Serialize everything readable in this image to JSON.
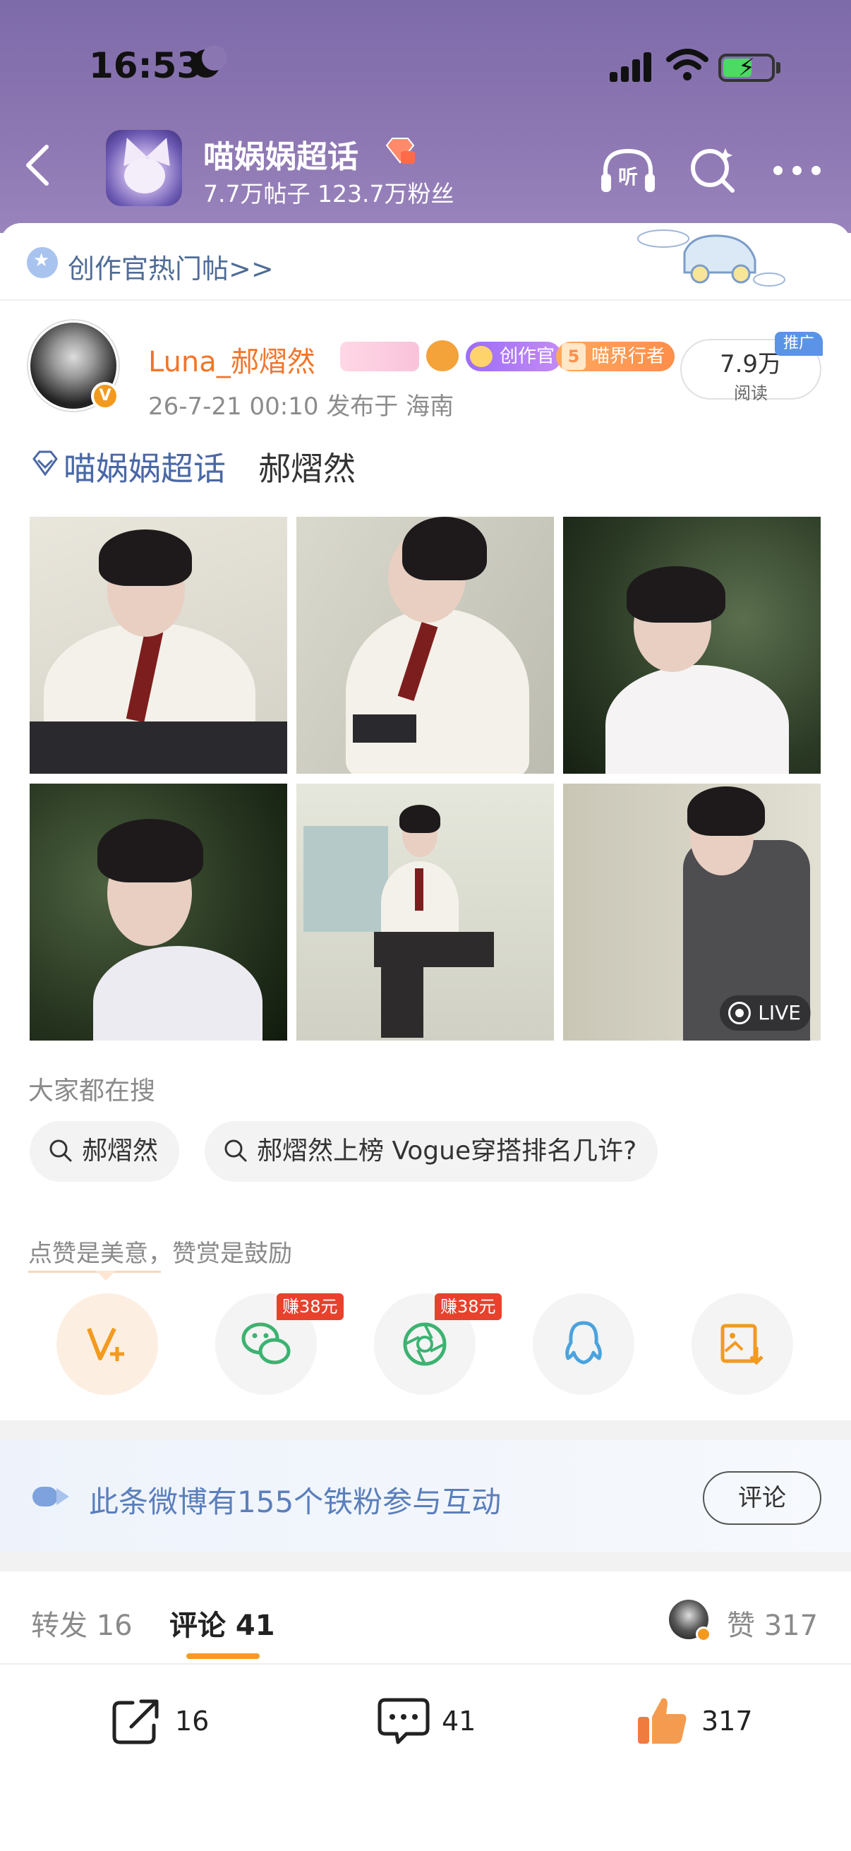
{
  "status": {
    "time": "16:53"
  },
  "header": {
    "group_name": "喵娲娲超话",
    "stats": "7.7万帖子 123.7万粉丝",
    "listen_label": "听"
  },
  "hot_bar": {
    "text": "创作官热门帖>>"
  },
  "post": {
    "username": "Luna_郝熠然",
    "creator_badge": "创作官",
    "explorer_badge": "喵界行者",
    "meta": "26-7-21 00:10  发布于 海南",
    "reads_num": "7.9万",
    "reads_label": "阅读",
    "promo_tag": "推广",
    "topic_link": "喵娲娲超话",
    "topic_text": "郝熠然",
    "live_label": "LIVE"
  },
  "search": {
    "heading": "大家都在搜",
    "chips": [
      "郝熠然",
      "郝熠然上榜 Vogue穿搭排名几许?"
    ]
  },
  "support": {
    "text": "点赞是美意，赞赏是鼓励",
    "earn_tag": "赚38元"
  },
  "fans": {
    "text": "此条微博有155个铁粉参与互动",
    "comment_button": "评论"
  },
  "tabs": {
    "repost": "转发 16",
    "comment": "评论 41",
    "like": "赞 317"
  },
  "actions": {
    "share_count": "16",
    "comment_count": "41",
    "like_count": "317"
  },
  "colors": {
    "header_bg": "#8e78b3",
    "accent_orange": "#f2752a",
    "link_blue": "#4a68a6"
  }
}
